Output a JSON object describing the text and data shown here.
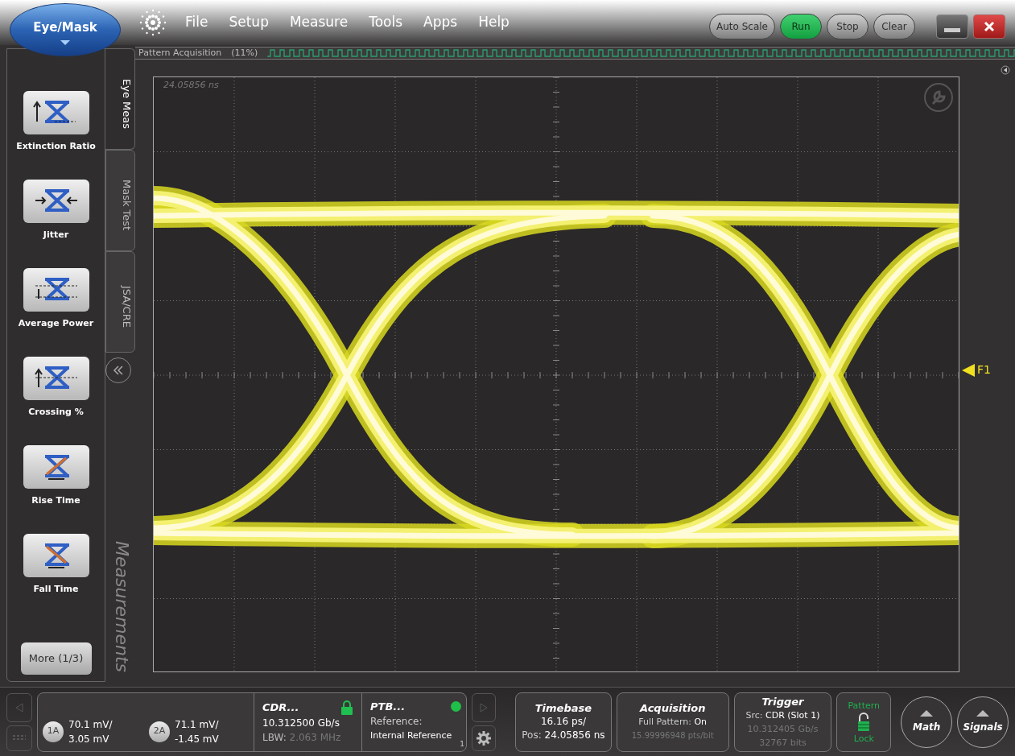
{
  "app_button": {
    "label": "Eye/Mask"
  },
  "menu": [
    "File",
    "Setup",
    "Measure",
    "Tools",
    "Apps",
    "Help"
  ],
  "toolbar_buttons": [
    {
      "label": "Auto Scale",
      "active": false
    },
    {
      "label": "Run",
      "active": true
    },
    {
      "label": "Stop",
      "active": false
    },
    {
      "label": "Clear",
      "active": false
    }
  ],
  "acquisition_bar": {
    "label": "Pattern Acquisition",
    "progress": "(11%)"
  },
  "measurements": [
    {
      "label": "Extinction Ratio",
      "kind": "ratio"
    },
    {
      "label": "Jitter",
      "kind": "jitter"
    },
    {
      "label": "Average Power",
      "kind": "power"
    },
    {
      "label": "Crossing %",
      "kind": "crossing"
    },
    {
      "label": "Rise Time",
      "kind": "rise"
    },
    {
      "label": "Fall Time",
      "kind": "fall"
    }
  ],
  "more_button": "More (1/3)",
  "side_tabs": [
    {
      "label": "Eye Meas",
      "selected": true
    },
    {
      "label": "Mask Test",
      "selected": false
    },
    {
      "label": "JSA/CRE",
      "selected": false
    }
  ],
  "panel_label": "Measurements",
  "display": {
    "timestamp": "24.05856 ns",
    "marker": "F1"
  },
  "status": {
    "channels": [
      {
        "badge": "1A",
        "scale": "70.1 mV/",
        "offset": "3.05 mV"
      },
      {
        "badge": "2A",
        "scale": "71.1 mV/",
        "offset": "-1.45 mV"
      }
    ],
    "cdr": {
      "title": "CDR...",
      "rate": "10.312500 Gb/s",
      "lbw_label": "LBW:",
      "lbw_value": "2.063 MHz",
      "locked": true
    },
    "ptb": {
      "title": "PTB...",
      "reference_label": "Reference:",
      "reference": "Internal Reference",
      "badge": "1",
      "color": "#1fbf4a"
    },
    "timebase": {
      "title": "Timebase",
      "scale": "16.16 ps/",
      "position_label": "Pos:",
      "position": "24.05856 ns"
    },
    "acquisition": {
      "title": "Acquisition",
      "mode_label": "Full Pattern:",
      "mode": "On",
      "detail": "15.99996948 pts/bit"
    },
    "trigger": {
      "title": "Trigger",
      "source_label": "Src:",
      "source": "CDR (Slot 1)",
      "rate": "10.312405 Gb/s",
      "length": "32767 bits"
    },
    "pattern_lock": {
      "top": "Pattern",
      "bottom": "Lock",
      "locked": true
    },
    "round_buttons": [
      "Math",
      "Signals"
    ]
  }
}
